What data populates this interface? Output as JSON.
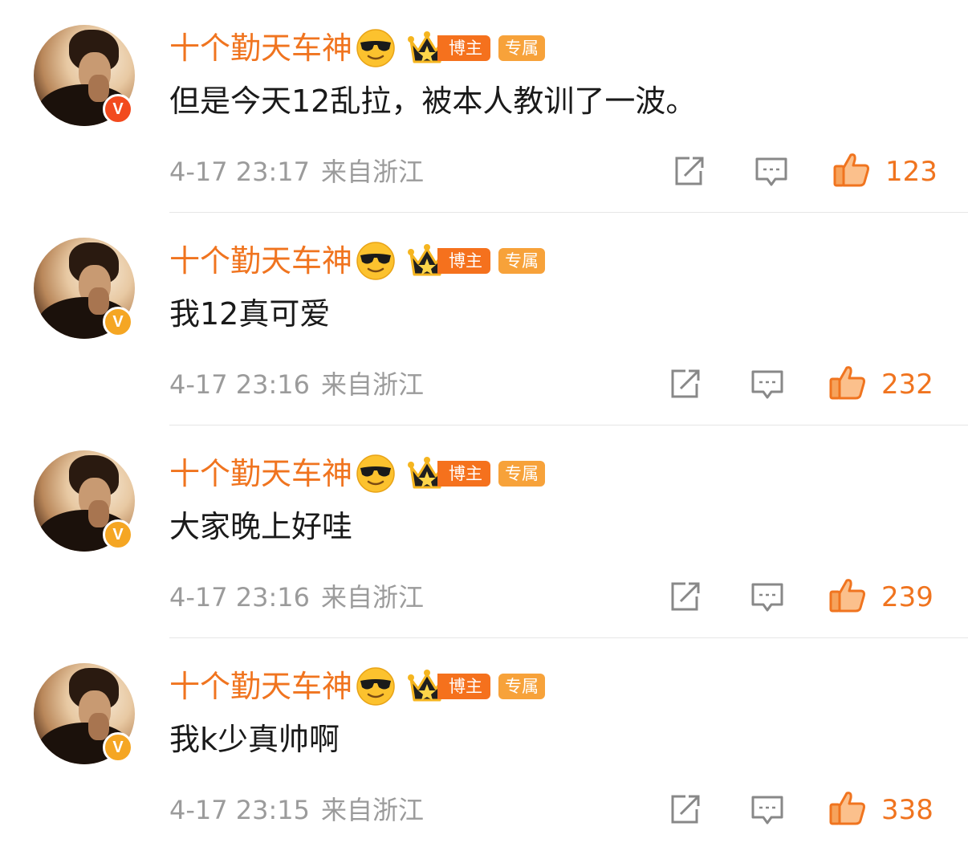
{
  "comments": [
    {
      "username": "十个勤天车神",
      "emoji_icon": "sunglasses-emoji-icon",
      "badge_crown_icon": "crown-icon",
      "badge_blogger": "博主",
      "badge_exclusive": "专属",
      "verified_color": "#f24a1e",
      "verified_mark": "V",
      "text": "但是今天12乱拉，被本人教训了一波。",
      "time": "4-17 23:17",
      "location": "来自浙江",
      "likes": "123"
    },
    {
      "username": "十个勤天车神",
      "emoji_icon": "sunglasses-emoji-icon",
      "badge_crown_icon": "crown-icon",
      "badge_blogger": "博主",
      "badge_exclusive": "专属",
      "verified_color": "#f5a623",
      "verified_mark": "V",
      "text": "我12真可爱",
      "time": "4-17 23:16",
      "location": "来自浙江",
      "likes": "232"
    },
    {
      "username": "十个勤天车神",
      "emoji_icon": "sunglasses-emoji-icon",
      "badge_crown_icon": "crown-icon",
      "badge_blogger": "博主",
      "badge_exclusive": "专属",
      "verified_color": "#f5a623",
      "verified_mark": "V",
      "text": "大家晚上好哇",
      "time": "4-17 23:16",
      "location": "来自浙江",
      "likes": "239"
    },
    {
      "username": "十个勤天车神",
      "emoji_icon": "sunglasses-emoji-icon",
      "badge_crown_icon": "crown-icon",
      "badge_blogger": "博主",
      "badge_exclusive": "专属",
      "verified_color": "#f5a623",
      "verified_mark": "V",
      "text": "我k少真帅啊",
      "time": "4-17 23:15",
      "location": "来自浙江",
      "likes": "338"
    }
  ],
  "icons": {
    "share": "share-icon",
    "reply": "comment-icon",
    "like": "thumbs-up-icon"
  },
  "colors": {
    "accent": "#f0741f",
    "meta_text": "#9b9b9b",
    "body_text": "#1a1a1a"
  }
}
